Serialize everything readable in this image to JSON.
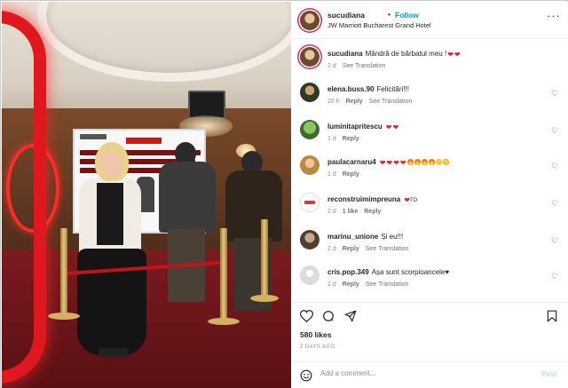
{
  "post": {
    "username": "sucudiana",
    "separator": "•",
    "follow_label": "Follow",
    "location": "JW Marriott Bucharest Grand Hotel",
    "more_label": "···"
  },
  "comments": [
    {
      "username": "sucudiana",
      "text": "Mândră de bărbatul meu !",
      "emojis": [
        "heart",
        "heart"
      ],
      "time": "2 d",
      "likes": "",
      "reply": "",
      "translate": "See Translation",
      "has_like": false,
      "avatar": "sucudiana"
    },
    {
      "username": "elena.buss.90",
      "text": "Felicitări!!!",
      "emojis": [],
      "time": "20 h",
      "likes": "",
      "reply": "Reply",
      "translate": "See Translation",
      "has_like": true,
      "avatar": "elena"
    },
    {
      "username": "luminitapritescu",
      "text": "",
      "emojis": [
        "heart",
        "heart"
      ],
      "time": "1 d",
      "likes": "",
      "reply": "Reply",
      "translate": "",
      "has_like": true,
      "avatar": "lumi"
    },
    {
      "username": "paulacarnaru4",
      "text": "",
      "emojis": [
        "heart",
        "heart",
        "heart",
        "heart",
        "fire",
        "fire",
        "fire",
        "fire",
        "face",
        "loveface"
      ],
      "time": "1 d",
      "likes": "",
      "reply": "Reply",
      "translate": "",
      "has_like": true,
      "avatar": "paula"
    },
    {
      "username": "reconstruimimpreuna",
      "text": "",
      "emojis": [
        "heart"
      ],
      "suffix": "TO",
      "time": "2 d",
      "likes": "1 like",
      "reply": "Reply",
      "translate": "",
      "has_like": true,
      "avatar": "recon"
    },
    {
      "username": "marinu_unione",
      "text": "Și eu!!!",
      "emojis": [],
      "time": "2 d",
      "likes": "",
      "reply": "Reply",
      "translate": "See Translation",
      "has_like": true,
      "avatar": "marinu"
    },
    {
      "username": "cris.pop.349",
      "text": "Așa sunt scorpioancele♥",
      "emojis": [],
      "time": "2 d",
      "likes": "",
      "reply": "Reply",
      "translate": "See Translation",
      "has_like": true,
      "avatar": "cris"
    }
  ],
  "stats": {
    "likes": "580 likes",
    "posted": "2 DAYS AGO"
  },
  "comment_box": {
    "placeholder": "Add a comment...",
    "post_label": "Post"
  },
  "icons": {
    "like": "heart-icon",
    "comment": "comment-icon",
    "share": "share-icon",
    "save": "bookmark-icon",
    "emoji": "emoji-icon",
    "more": "more-icon"
  },
  "colors": {
    "accent": "#0095f6",
    "story_ring": "#d62976",
    "heart_emoji": "#e0242e",
    "post_disabled": "#b3dbff"
  }
}
